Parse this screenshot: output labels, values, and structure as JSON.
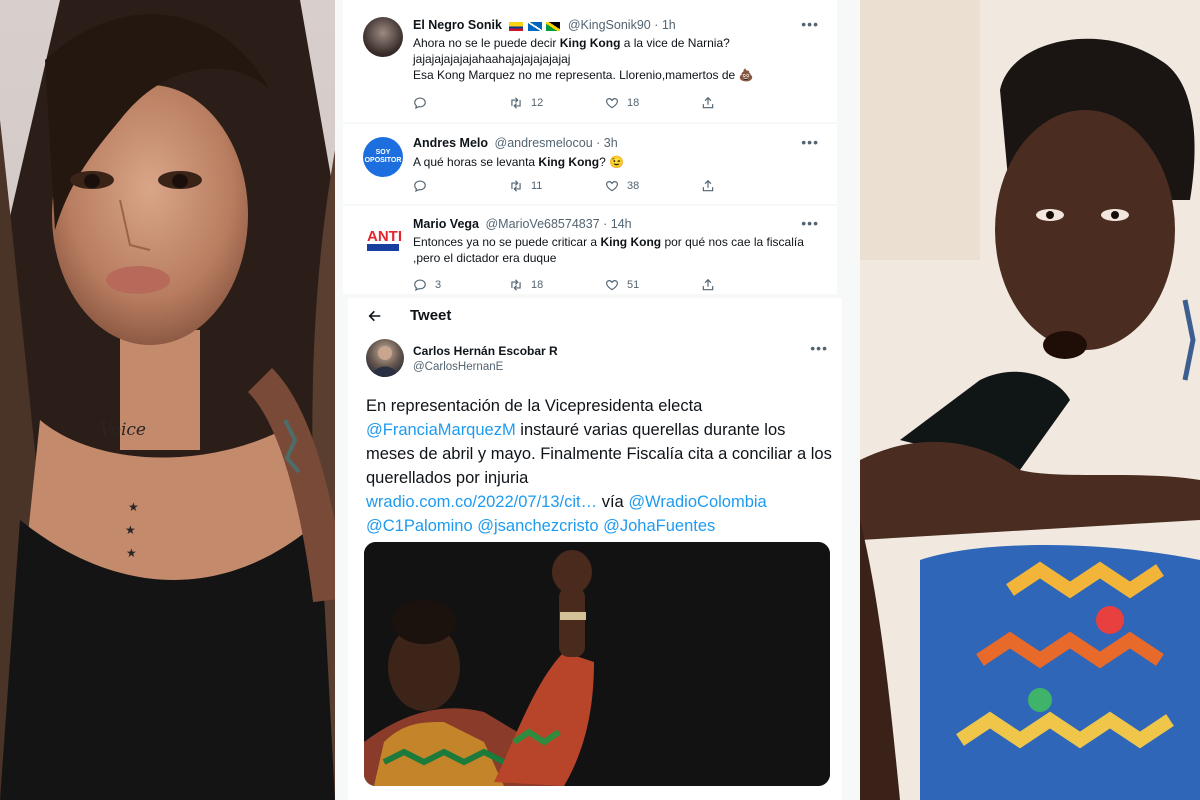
{
  "tweets": [
    {
      "name": "El Negro Sonik",
      "handle": "@KingSonik90 · 1h",
      "text_parts": [
        "Ahora no se le puede decir ",
        "King Kong",
        " a la vice de Narnia?",
        "jajajajajajajahaahajajajajajajaj",
        "Esa Kong Marquez no me representa. Llorenio,mamertos de 💩"
      ],
      "replies": "",
      "retweets": "12",
      "likes": "18"
    },
    {
      "name": "Andres Melo",
      "handle": "@andresmelocou · 3h",
      "avatar_text": "SOY OPOSITOR",
      "text_parts": [
        "A qué horas se levanta ",
        "King Kong",
        "? 😉"
      ],
      "replies": "",
      "retweets": "11",
      "likes": "38"
    },
    {
      "name": "Mario Vega",
      "handle": "@MarioVe68574837 · 14h",
      "avatar_text": "ANTI PETRISTA",
      "text_parts": [
        "Entonces ya no se puede criticar a ",
        "King Kong",
        " por qué nos cae la fiscalía",
        ",pero el dictador era duque"
      ],
      "replies": "3",
      "retweets": "18",
      "likes": "51"
    }
  ],
  "detail": {
    "header": "Tweet",
    "name": "Carlos Hernán Escobar R",
    "handle": "@CarlosHernanE",
    "text_1": "En representación de la Vicepresidenta electa",
    "mention_1": "@FranciaMarquezM",
    "text_2": " instauré varias querellas durante los meses de abril y mayo. Finalmente Fiscalía cita a conciliar a los querellados por injuria",
    "link": "wradio.com.co/2022/07/13/cit…",
    "text_3": " vía ",
    "mention_2": "@WradioColombia",
    "mention_3": "@C1Palomino",
    "mention_4": "@jsanchezcristo",
    "mention_5": "@JohaFuentes"
  },
  "photo_left": {
    "tattoo_text": "Voice"
  },
  "colors": {
    "link": "#1d9bf0",
    "secondary": "#536471",
    "text": "#0f1419"
  }
}
